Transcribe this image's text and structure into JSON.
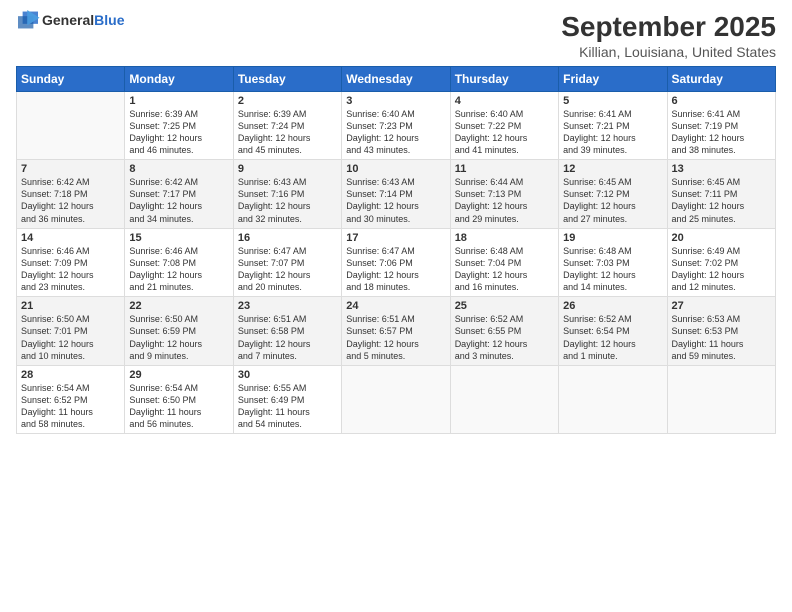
{
  "logo": {
    "line1": "General",
    "line2": "Blue"
  },
  "title": "September 2025",
  "subtitle": "Killian, Louisiana, United States",
  "weekdays": [
    "Sunday",
    "Monday",
    "Tuesday",
    "Wednesday",
    "Thursday",
    "Friday",
    "Saturday"
  ],
  "weeks": [
    [
      {
        "day": "",
        "info": ""
      },
      {
        "day": "1",
        "info": "Sunrise: 6:39 AM\nSunset: 7:25 PM\nDaylight: 12 hours\nand 46 minutes."
      },
      {
        "day": "2",
        "info": "Sunrise: 6:39 AM\nSunset: 7:24 PM\nDaylight: 12 hours\nand 45 minutes."
      },
      {
        "day": "3",
        "info": "Sunrise: 6:40 AM\nSunset: 7:23 PM\nDaylight: 12 hours\nand 43 minutes."
      },
      {
        "day": "4",
        "info": "Sunrise: 6:40 AM\nSunset: 7:22 PM\nDaylight: 12 hours\nand 41 minutes."
      },
      {
        "day": "5",
        "info": "Sunrise: 6:41 AM\nSunset: 7:21 PM\nDaylight: 12 hours\nand 39 minutes."
      },
      {
        "day": "6",
        "info": "Sunrise: 6:41 AM\nSunset: 7:19 PM\nDaylight: 12 hours\nand 38 minutes."
      }
    ],
    [
      {
        "day": "7",
        "info": "Sunrise: 6:42 AM\nSunset: 7:18 PM\nDaylight: 12 hours\nand 36 minutes."
      },
      {
        "day": "8",
        "info": "Sunrise: 6:42 AM\nSunset: 7:17 PM\nDaylight: 12 hours\nand 34 minutes."
      },
      {
        "day": "9",
        "info": "Sunrise: 6:43 AM\nSunset: 7:16 PM\nDaylight: 12 hours\nand 32 minutes."
      },
      {
        "day": "10",
        "info": "Sunrise: 6:43 AM\nSunset: 7:14 PM\nDaylight: 12 hours\nand 30 minutes."
      },
      {
        "day": "11",
        "info": "Sunrise: 6:44 AM\nSunset: 7:13 PM\nDaylight: 12 hours\nand 29 minutes."
      },
      {
        "day": "12",
        "info": "Sunrise: 6:45 AM\nSunset: 7:12 PM\nDaylight: 12 hours\nand 27 minutes."
      },
      {
        "day": "13",
        "info": "Sunrise: 6:45 AM\nSunset: 7:11 PM\nDaylight: 12 hours\nand 25 minutes."
      }
    ],
    [
      {
        "day": "14",
        "info": "Sunrise: 6:46 AM\nSunset: 7:09 PM\nDaylight: 12 hours\nand 23 minutes."
      },
      {
        "day": "15",
        "info": "Sunrise: 6:46 AM\nSunset: 7:08 PM\nDaylight: 12 hours\nand 21 minutes."
      },
      {
        "day": "16",
        "info": "Sunrise: 6:47 AM\nSunset: 7:07 PM\nDaylight: 12 hours\nand 20 minutes."
      },
      {
        "day": "17",
        "info": "Sunrise: 6:47 AM\nSunset: 7:06 PM\nDaylight: 12 hours\nand 18 minutes."
      },
      {
        "day": "18",
        "info": "Sunrise: 6:48 AM\nSunset: 7:04 PM\nDaylight: 12 hours\nand 16 minutes."
      },
      {
        "day": "19",
        "info": "Sunrise: 6:48 AM\nSunset: 7:03 PM\nDaylight: 12 hours\nand 14 minutes."
      },
      {
        "day": "20",
        "info": "Sunrise: 6:49 AM\nSunset: 7:02 PM\nDaylight: 12 hours\nand 12 minutes."
      }
    ],
    [
      {
        "day": "21",
        "info": "Sunrise: 6:50 AM\nSunset: 7:01 PM\nDaylight: 12 hours\nand 10 minutes."
      },
      {
        "day": "22",
        "info": "Sunrise: 6:50 AM\nSunset: 6:59 PM\nDaylight: 12 hours\nand 9 minutes."
      },
      {
        "day": "23",
        "info": "Sunrise: 6:51 AM\nSunset: 6:58 PM\nDaylight: 12 hours\nand 7 minutes."
      },
      {
        "day": "24",
        "info": "Sunrise: 6:51 AM\nSunset: 6:57 PM\nDaylight: 12 hours\nand 5 minutes."
      },
      {
        "day": "25",
        "info": "Sunrise: 6:52 AM\nSunset: 6:55 PM\nDaylight: 12 hours\nand 3 minutes."
      },
      {
        "day": "26",
        "info": "Sunrise: 6:52 AM\nSunset: 6:54 PM\nDaylight: 12 hours\nand 1 minute."
      },
      {
        "day": "27",
        "info": "Sunrise: 6:53 AM\nSunset: 6:53 PM\nDaylight: 11 hours\nand 59 minutes."
      }
    ],
    [
      {
        "day": "28",
        "info": "Sunrise: 6:54 AM\nSunset: 6:52 PM\nDaylight: 11 hours\nand 58 minutes."
      },
      {
        "day": "29",
        "info": "Sunrise: 6:54 AM\nSunset: 6:50 PM\nDaylight: 11 hours\nand 56 minutes."
      },
      {
        "day": "30",
        "info": "Sunrise: 6:55 AM\nSunset: 6:49 PM\nDaylight: 11 hours\nand 54 minutes."
      },
      {
        "day": "",
        "info": ""
      },
      {
        "day": "",
        "info": ""
      },
      {
        "day": "",
        "info": ""
      },
      {
        "day": "",
        "info": ""
      }
    ]
  ]
}
